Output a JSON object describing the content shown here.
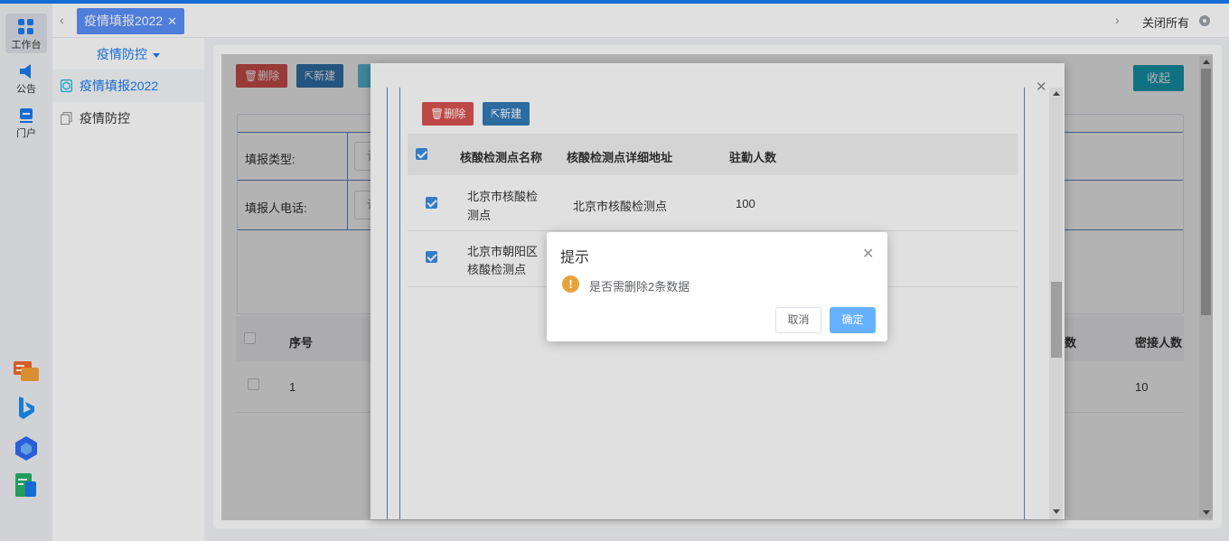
{
  "rail": {
    "items": [
      {
        "label": "工作台",
        "icon": "grid-icon"
      },
      {
        "label": "公告",
        "icon": "megaphone-icon"
      },
      {
        "label": "门户",
        "icon": "portal-icon"
      }
    ],
    "apps": [
      "chat-app-icon",
      "bing-app-icon",
      "cube-app-icon",
      "doc-app-icon"
    ]
  },
  "tabs": {
    "active": "疫情填报2022",
    "close_all": "关闭所有"
  },
  "submenu": {
    "title": "疫情防控",
    "items": [
      "疫情填报2022",
      "疫情防控"
    ]
  },
  "toolbar": {
    "delete": "删除",
    "new": "新建",
    "collapse": "收起"
  },
  "form": {
    "type_label": "填报类型:",
    "phone_label": "填报人电话:",
    "placeholder_char": "请"
  },
  "table": {
    "headers": {
      "index": "序号",
      "count_partial": "数",
      "close_contacts": "密接人数"
    },
    "rows": [
      {
        "index": "1",
        "close_contacts": "10"
      }
    ]
  },
  "layer": {
    "delete": "删除",
    "new": "新建",
    "headers": [
      "核酸检测点名称",
      "核酸检测点详细地址",
      "驻勤人数"
    ],
    "rows": [
      {
        "name_line1": "北京市核酸检",
        "name_line2": "测点",
        "address": "北京市核酸检测点",
        "staff": "100",
        "checked": true
      },
      {
        "name_line1": "北京市朝阳区",
        "name_line2": "核酸检测点",
        "address": "",
        "staff": "",
        "checked": true
      }
    ]
  },
  "confirm": {
    "title": "提示",
    "message": "是否需删除2条数据",
    "cancel": "取消",
    "ok": "确定"
  },
  "colors": {
    "accent": "#1a7cf0",
    "danger": "#d9534f",
    "primary": "#337ab7",
    "warning": "#e6a23c"
  }
}
